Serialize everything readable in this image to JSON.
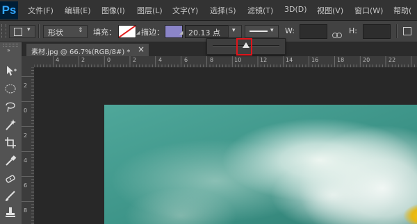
{
  "app": {
    "logo": "Ps"
  },
  "menu": [
    {
      "label": "文件(F)"
    },
    {
      "label": "编辑(E)"
    },
    {
      "label": "图像(I)"
    },
    {
      "label": "图层(L)"
    },
    {
      "label": "文字(Y)"
    },
    {
      "label": "选择(S)"
    },
    {
      "label": "滤镜(T)"
    },
    {
      "label": "3D(D)"
    },
    {
      "label": "视图(V)"
    },
    {
      "label": "窗口(W)"
    },
    {
      "label": "帮助("
    }
  ],
  "options": {
    "shape_mode": "形状",
    "fill_label": "填充：",
    "stroke_label": "描边：",
    "stroke_width": "20.13 点",
    "w_label": "W:",
    "h_label": "H:",
    "stroke_color": "#8b85c8",
    "slider_value_fraction": 0.5
  },
  "document": {
    "tab_title": "素材.jpg @ 66.7%(RGB/8#) *",
    "close_glyph": "×"
  },
  "ruler": {
    "h_labels": [
      "4",
      "2",
      "0",
      "2",
      "4",
      "6",
      "8",
      "10",
      "12",
      "14",
      "16",
      "18",
      "20",
      "22"
    ],
    "v_labels": [
      "2",
      "0",
      "2",
      "4",
      "6",
      "8"
    ]
  },
  "icons": {
    "move": "move-icon",
    "marquee": "ellipse-marquee-icon",
    "lasso": "lasso-icon",
    "magic": "magic-wand-icon",
    "crop": "crop-icon",
    "eyedropper": "eyedropper-icon",
    "healing": "healing-brush-icon",
    "brush": "brush-icon",
    "stamp": "clone-stamp-icon"
  }
}
